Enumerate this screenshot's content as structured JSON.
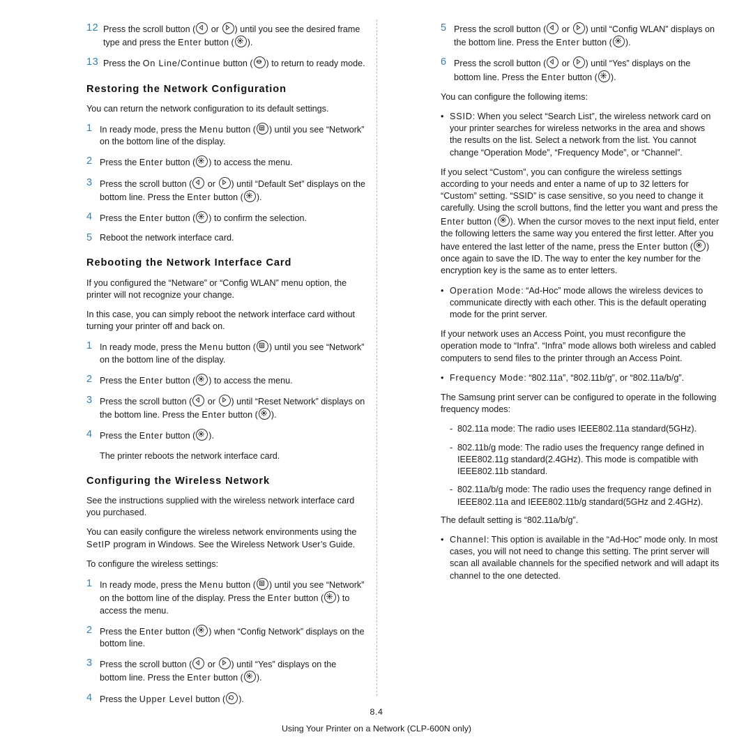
{
  "page": {
    "number": "8.4",
    "footer": "Using Your Printer on a Network (CLP-600N only)"
  },
  "left_column": {
    "steps_top": [
      {
        "num": "12",
        "parts": [
          {
            "t": "text",
            "v": "Press the scroll button ("
          },
          {
            "t": "icon",
            "v": "left-arrow-button"
          },
          {
            "t": "text",
            "v": " or "
          },
          {
            "t": "icon",
            "v": "right-arrow-button"
          },
          {
            "t": "text",
            "v": ") until you see the desired frame type and press the "
          },
          {
            "t": "sp",
            "v": "Enter"
          },
          {
            "t": "text",
            "v": " button ("
          },
          {
            "t": "icon",
            "v": "enter-button"
          },
          {
            "t": "text",
            "v": ")."
          }
        ]
      },
      {
        "num": "13",
        "parts": [
          {
            "t": "text",
            "v": "Press the "
          },
          {
            "t": "sp",
            "v": "On Line/Continue"
          },
          {
            "t": "text",
            "v": " button ("
          },
          {
            "t": "icon",
            "v": "online-continue-button"
          },
          {
            "t": "text",
            "v": ") to return to ready mode."
          }
        ]
      }
    ],
    "section1": {
      "heading": "Restoring the Network Configuration",
      "intro": "You can return the network configuration to its default settings.",
      "steps": [
        {
          "num": "1",
          "parts": [
            {
              "t": "text",
              "v": "In ready mode, press the "
            },
            {
              "t": "sp",
              "v": "Menu"
            },
            {
              "t": "text",
              "v": " button ("
            },
            {
              "t": "icon",
              "v": "menu-button"
            },
            {
              "t": "text",
              "v": ") until you see “Network” on the bottom line of the display."
            }
          ]
        },
        {
          "num": "2",
          "parts": [
            {
              "t": "text",
              "v": "Press the "
            },
            {
              "t": "sp",
              "v": "Enter"
            },
            {
              "t": "text",
              "v": " button ("
            },
            {
              "t": "icon",
              "v": "enter-button"
            },
            {
              "t": "text",
              "v": ") to access the menu."
            }
          ]
        },
        {
          "num": "3",
          "parts": [
            {
              "t": "text",
              "v": "Press the scroll button ("
            },
            {
              "t": "icon",
              "v": "left-arrow-button"
            },
            {
              "t": "text",
              "v": " or "
            },
            {
              "t": "icon",
              "v": "right-arrow-button"
            },
            {
              "t": "text",
              "v": ") until “Default Set” displays on the bottom line. Press the "
            },
            {
              "t": "sp",
              "v": "Enter"
            },
            {
              "t": "text",
              "v": " button ("
            },
            {
              "t": "icon",
              "v": "enter-button"
            },
            {
              "t": "text",
              "v": ")."
            }
          ]
        },
        {
          "num": "4",
          "parts": [
            {
              "t": "text",
              "v": "Press the "
            },
            {
              "t": "sp",
              "v": "Enter"
            },
            {
              "t": "text",
              "v": " button ("
            },
            {
              "t": "icon",
              "v": "enter-button"
            },
            {
              "t": "text",
              "v": ") to confirm the selection."
            }
          ]
        },
        {
          "num": "5",
          "parts": [
            {
              "t": "text",
              "v": "Reboot the network interface card."
            }
          ]
        }
      ]
    },
    "section2": {
      "heading": "Rebooting the Network Interface Card",
      "para1": "If you configured the “Netware” or “Config WLAN” menu option, the printer will not recognize your change.",
      "para2": "In this case, you can simply reboot the network interface card without turning your printer off and back on.",
      "steps": [
        {
          "num": "1",
          "parts": [
            {
              "t": "text",
              "v": "In ready mode, press the "
            },
            {
              "t": "sp",
              "v": "Menu"
            },
            {
              "t": "text",
              "v": " button ("
            },
            {
              "t": "icon",
              "v": "menu-button"
            },
            {
              "t": "text",
              "v": ") until you see “Network” on the bottom line of the display."
            }
          ]
        },
        {
          "num": "2",
          "parts": [
            {
              "t": "text",
              "v": "Press the "
            },
            {
              "t": "sp",
              "v": "Enter"
            },
            {
              "t": "text",
              "v": " button ("
            },
            {
              "t": "icon",
              "v": "enter-button"
            },
            {
              "t": "text",
              "v": ") to access the menu."
            }
          ]
        },
        {
          "num": "3",
          "parts": [
            {
              "t": "text",
              "v": "Press the scroll button ("
            },
            {
              "t": "icon",
              "v": "left-arrow-button"
            },
            {
              "t": "text",
              "v": " or "
            },
            {
              "t": "icon",
              "v": "right-arrow-button"
            },
            {
              "t": "text",
              "v": ") until “Reset Network” displays on the bottom line. Press the "
            },
            {
              "t": "sp",
              "v": "Enter"
            },
            {
              "t": "text",
              "v": " button ("
            },
            {
              "t": "icon",
              "v": "enter-button"
            },
            {
              "t": "text",
              "v": ")."
            }
          ]
        },
        {
          "num": "4",
          "parts": [
            {
              "t": "text",
              "v": "Press the "
            },
            {
              "t": "sp",
              "v": "Enter"
            },
            {
              "t": "text",
              "v": " button ("
            },
            {
              "t": "icon",
              "v": "enter-button"
            },
            {
              "t": "text",
              "v": ")."
            }
          ]
        }
      ],
      "after_steps": "The printer reboots the network interface card."
    },
    "section3": {
      "heading": "Configuring the Wireless Network",
      "para1": "See the instructions supplied with the wireless network interface card you purchased.",
      "para2_parts": [
        {
          "t": "text",
          "v": "You can easily configure the wireless network environments using the "
        },
        {
          "t": "sp",
          "v": "SetIP"
        },
        {
          "t": "text",
          "v": " program in Windows. See the Wireless Network User’s Guide."
        }
      ],
      "para3": "To configure the wireless settings:",
      "steps": [
        {
          "num": "1",
          "parts": [
            {
              "t": "text",
              "v": "In ready mode, press the "
            },
            {
              "t": "sp",
              "v": "Menu"
            },
            {
              "t": "text",
              "v": " button ("
            },
            {
              "t": "icon",
              "v": "menu-button"
            },
            {
              "t": "text",
              "v": ") until you see “Network” on the bottom line of the display. Press the "
            },
            {
              "t": "sp",
              "v": "Enter"
            },
            {
              "t": "text",
              "v": " button ("
            },
            {
              "t": "icon",
              "v": "enter-button"
            },
            {
              "t": "text",
              "v": ") to access the menu."
            }
          ]
        },
        {
          "num": "2",
          "parts": [
            {
              "t": "text",
              "v": "Press the "
            },
            {
              "t": "sp",
              "v": "Enter"
            },
            {
              "t": "text",
              "v": " button ("
            },
            {
              "t": "icon",
              "v": "enter-button"
            },
            {
              "t": "text",
              "v": ") when “Config Network” displays on the bottom line."
            }
          ]
        },
        {
          "num": "3",
          "parts": [
            {
              "t": "text",
              "v": "Press the scroll button ("
            },
            {
              "t": "icon",
              "v": "left-arrow-button"
            },
            {
              "t": "text",
              "v": " or "
            },
            {
              "t": "icon",
              "v": "right-arrow-button"
            },
            {
              "t": "text",
              "v": ") until “Yes” displays on the bottom line. Press the "
            },
            {
              "t": "sp",
              "v": "Enter"
            },
            {
              "t": "text",
              "v": " button ("
            },
            {
              "t": "icon",
              "v": "enter-button"
            },
            {
              "t": "text",
              "v": ")."
            }
          ]
        },
        {
          "num": "4",
          "parts": [
            {
              "t": "text",
              "v": "Press the "
            },
            {
              "t": "sp",
              "v": "Upper Level"
            },
            {
              "t": "text",
              "v": " button ("
            },
            {
              "t": "icon",
              "v": "upper-level-button"
            },
            {
              "t": "text",
              "v": ")."
            }
          ]
        }
      ]
    }
  },
  "right_column": {
    "steps_top": [
      {
        "num": "5",
        "parts": [
          {
            "t": "text",
            "v": "Press the scroll button ("
          },
          {
            "t": "icon",
            "v": "left-arrow-button"
          },
          {
            "t": "text",
            "v": " or "
          },
          {
            "t": "icon",
            "v": "right-arrow-button"
          },
          {
            "t": "text",
            "v": ") until “Config WLAN” displays on the bottom line. Press the "
          },
          {
            "t": "sp",
            "v": "Enter"
          },
          {
            "t": "text",
            "v": " button ("
          },
          {
            "t": "icon",
            "v": "enter-button"
          },
          {
            "t": "text",
            "v": ")."
          }
        ]
      },
      {
        "num": "6",
        "parts": [
          {
            "t": "text",
            "v": "Press the scroll button ("
          },
          {
            "t": "icon",
            "v": "left-arrow-button"
          },
          {
            "t": "text",
            "v": " or "
          },
          {
            "t": "icon",
            "v": "right-arrow-button"
          },
          {
            "t": "text",
            "v": ") until “Yes” displays on the bottom line. Press the "
          },
          {
            "t": "sp",
            "v": "Enter"
          },
          {
            "t": "text",
            "v": " button ("
          },
          {
            "t": "icon",
            "v": "enter-button"
          },
          {
            "t": "text",
            "v": ")."
          }
        ]
      }
    ],
    "intro": "You can configure the following items:",
    "bullets": [
      {
        "parts": [
          {
            "t": "sp",
            "v": "SSID"
          },
          {
            "t": "text",
            "v": ": When you select “Search List”, the wireless network card on your printer searches for wireless networks in the area and shows the results on the list. Select a network from the list. You cannot change “Operation Mode”, “Frequency Mode”, or “Channel”."
          }
        ],
        "sub": [
          {
            "parts": [
              {
                "t": "text",
                "v": "If you select “Custom”, you can configure the wireless settings according to your needs and enter a name of up to 32 letters for “Custom” setting. “SSID” is case sensitive, so you need to change it carefully. Using the scroll buttons, find the letter you want and press the "
              },
              {
                "t": "sp",
                "v": "Enter"
              },
              {
                "t": "text",
                "v": " button ("
              },
              {
                "t": "icon",
                "v": "enter-button"
              },
              {
                "t": "text",
                "v": "). When the cursor moves to the next input field, enter the following letters the same way you entered the first letter. After you have entered the last letter of the name, press the "
              },
              {
                "t": "sp",
                "v": "Enter"
              },
              {
                "t": "text",
                "v": " button ("
              },
              {
                "t": "icon",
                "v": "enter-button"
              },
              {
                "t": "text",
                "v": ") once again to save the ID. The way to enter the key number for the encryption key is the same as to enter letters."
              }
            ]
          }
        ]
      },
      {
        "parts": [
          {
            "t": "sp",
            "v": "Operation Mode"
          },
          {
            "t": "text",
            "v": ": “Ad-Hoc” mode allows the wireless devices to communicate directly with each other. This is the default operating mode for the print server."
          }
        ],
        "sub": [
          {
            "parts": [
              {
                "t": "text",
                "v": "If your network uses an Access Point, you must reconfigure the operation mode to “Infra”. “Infra” mode allows both wireless and cabled computers to send files to the printer through an Access Point."
              }
            ]
          }
        ]
      },
      {
        "parts": [
          {
            "t": "sp",
            "v": "Frequency Mode"
          },
          {
            "t": "text",
            "v": ": “802.11a”, “802.11b/g”, or “802.11a/b/g”."
          }
        ],
        "sub": [
          {
            "parts": [
              {
                "t": "text",
                "v": "The Samsung print server can be configured to operate in the following frequency modes:"
              }
            ]
          }
        ],
        "dashes": [
          "802.11a mode: The radio uses IEEE802.11a standard(5GHz).",
          "802.11b/g mode: The radio uses the frequency range defined in IEEE802.11g standard(2.4GHz). This mode is compatible with IEEE802.11b standard.",
          "802.11a/b/g mode: The radio uses the frequency range defined in IEEE802.11a and IEEE802.11b/g standard(5GHz and 2.4GHz)."
        ],
        "after_dashes": "The default setting is “802.11a/b/g”."
      },
      {
        "parts": [
          {
            "t": "sp",
            "v": "Channel"
          },
          {
            "t": "text",
            "v": ": This option is available in the “Ad-Hoc” mode only. In most cases, you will not need to change this setting. The print server will scan all available channels for the specified network and will adapt its channel to the one detected."
          }
        ]
      }
    ]
  },
  "colors": {
    "step_number": "#3a7fa8",
    "text": "#1a1a1a",
    "divider": "#b9b9b9"
  }
}
